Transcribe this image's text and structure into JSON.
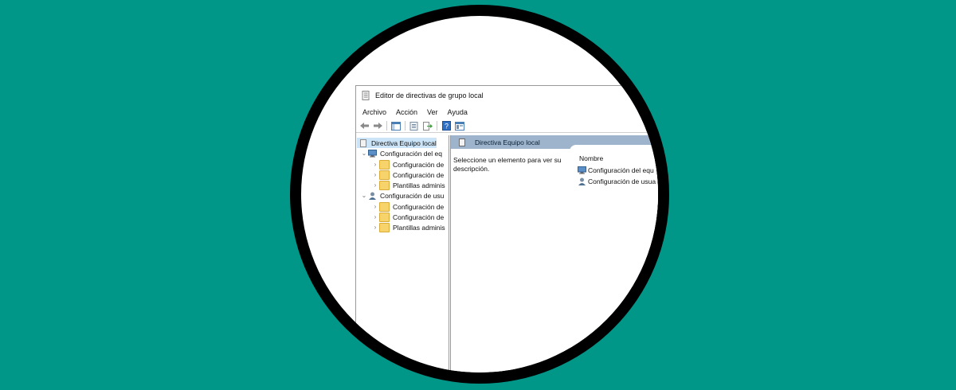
{
  "window": {
    "title": "Editor de directivas de grupo local"
  },
  "menu": [
    "Archivo",
    "Acción",
    "Ver",
    "Ayuda"
  ],
  "toolbar": {
    "icons": [
      "back-icon",
      "forward-icon",
      "show-hide-tree-icon",
      "properties-icon",
      "export-list-icon",
      "help-icon",
      "view-icon"
    ]
  },
  "tree": {
    "root": "Directiva Equipo local",
    "computer_config": {
      "label": "Configuración del eq",
      "children": [
        "Configuración de",
        "Configuración de",
        "Plantillas adminis"
      ]
    },
    "user_config": {
      "label": "Configuración de usu",
      "children": [
        "Configuración de",
        "Configuración de",
        "Plantillas adminis"
      ]
    }
  },
  "right_pane": {
    "header": "Directiva Equipo local",
    "description": "Seleccione un elemento para ver su descripción.",
    "column_header": "Nombre",
    "items": [
      "Configuración del equ",
      "Configuración de usua"
    ]
  },
  "colors": {
    "background": "#009688",
    "ring": "#000000",
    "header_band": "#9db4cc",
    "folder": "#f6d46b"
  }
}
